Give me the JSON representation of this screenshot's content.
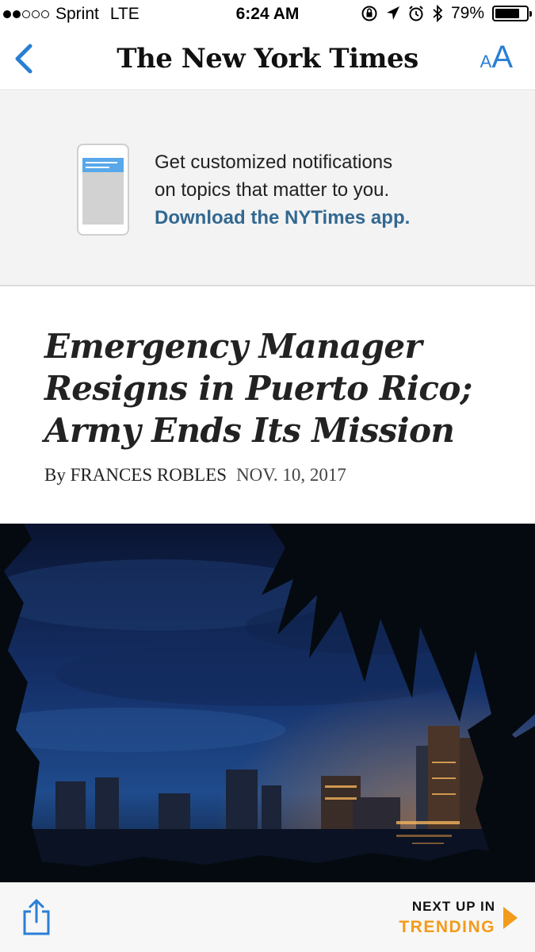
{
  "status_bar": {
    "carrier": "Sprint",
    "network": "LTE",
    "time": "6:24 AM",
    "battery": "79%",
    "battery_level": 0.79,
    "icons": [
      "orientation-lock-icon",
      "location-icon",
      "alarm-icon",
      "bluetooth-icon",
      "battery-icon"
    ]
  },
  "nav": {
    "masthead": "The New York Times",
    "font_size_small": "A",
    "font_size_large": "A",
    "accent_color": "#2a7fd4"
  },
  "promo": {
    "line1": "Get customized notifications",
    "line2": "on topics that matter to you.",
    "link": "Download the NYTimes app.",
    "link_color": "#326891"
  },
  "article": {
    "headline_line1": "Emergency Manager",
    "headline_line2": "Resigns in Puerto Rico;",
    "headline_line3": "Army Ends Its Mission",
    "byline": "By FRANCES ROBLES",
    "date": "NOV. 10, 2017"
  },
  "bottom_bar": {
    "next_up_label": "NEXT UP IN",
    "next_up_section": "TRENDING",
    "accent_color": "#f39b1c"
  }
}
